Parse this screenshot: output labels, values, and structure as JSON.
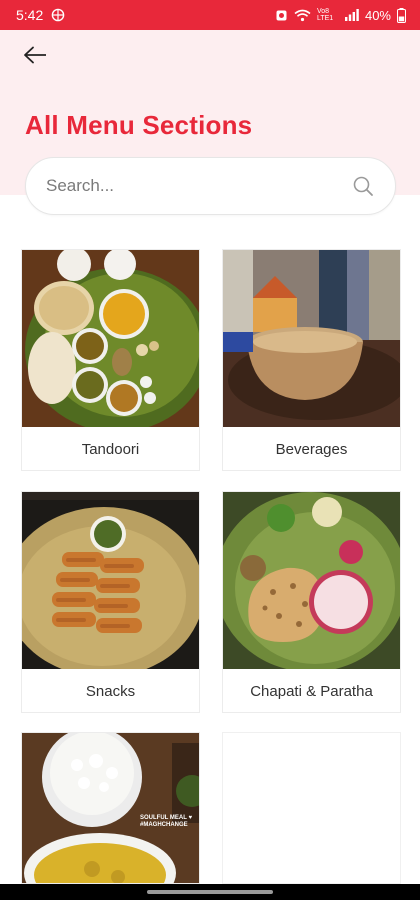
{
  "status_bar": {
    "time": "5:42",
    "battery": "40%",
    "network_label": "Vo8 LTE1"
  },
  "header": {
    "back_icon": "arrow-left-icon",
    "title": "All Menu Sections"
  },
  "search": {
    "placeholder": "Search...",
    "value": "",
    "icon": "search-icon"
  },
  "sections": [
    {
      "label": "Tandoori",
      "image": "thali-plate-photo"
    },
    {
      "label": "Beverages",
      "image": "chai-cup-photo"
    },
    {
      "label": "Snacks",
      "image": "kebab-leaf-photo"
    },
    {
      "label": "Chapati & Paratha",
      "image": "paratha-leaf-photo"
    },
    {
      "label": "",
      "image": "rice-dal-photo",
      "overlay_text": "SOULFUL MEAL ♥ #MAGHCHANGE"
    }
  ],
  "colors": {
    "accent": "#e8283a",
    "header_bg": "#fdeef0"
  }
}
